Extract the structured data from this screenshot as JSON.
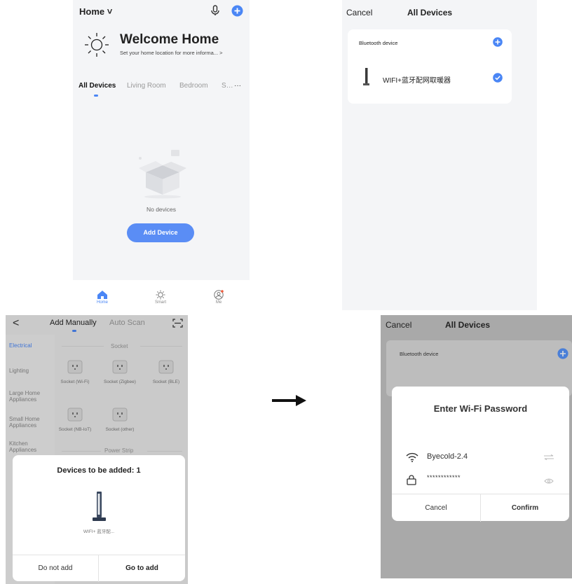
{
  "home": {
    "title": "Home ˅",
    "welcome": "Welcome Home",
    "location_hint": "Set your home location for more informa... >",
    "tabs": [
      "All Devices",
      "Living Room",
      "Bedroom",
      "S…",
      "···"
    ],
    "empty_text": "No devices",
    "add_button": "Add Device",
    "nav": [
      "Home",
      "Smart",
      "Me"
    ],
    "accent": "#4a86f5"
  },
  "all_devices": {
    "cancel": "Cancel",
    "title": "All Devices",
    "section": "Bluetooth device",
    "device_name": "WIFI+蓝牙配网取暖器"
  },
  "add_manually": {
    "back": "<",
    "tab_manual": "Add Manually",
    "tab_scan": "Auto Scan",
    "categories": [
      "Electrical",
      "Lighting",
      "Large Home Appliances",
      "Small Home Appliances",
      "Kitchen Appliances"
    ],
    "section_socket": "Socket",
    "sockets": [
      "Socket (Wi-Fi)",
      "Socket (Zigbee)",
      "Socket (BLE)",
      "Socket (NB-IoT)",
      "Socket (other)"
    ],
    "section_strip": "Power Strip",
    "dialog": {
      "title": "Devices to be added: 1",
      "device": "WIFI+ 蓝牙配...",
      "no_button": "Do not add",
      "go_button": "Go to add"
    }
  },
  "wifi_dialog": {
    "cancel": "Cancel",
    "title": "All Devices",
    "section": "Bluetooth device",
    "dialog_title": "Enter Wi-Fi Password",
    "ssid": "Byecold-2.4",
    "password": "************",
    "cancel_button": "Cancel",
    "confirm_button": "Confirm"
  }
}
